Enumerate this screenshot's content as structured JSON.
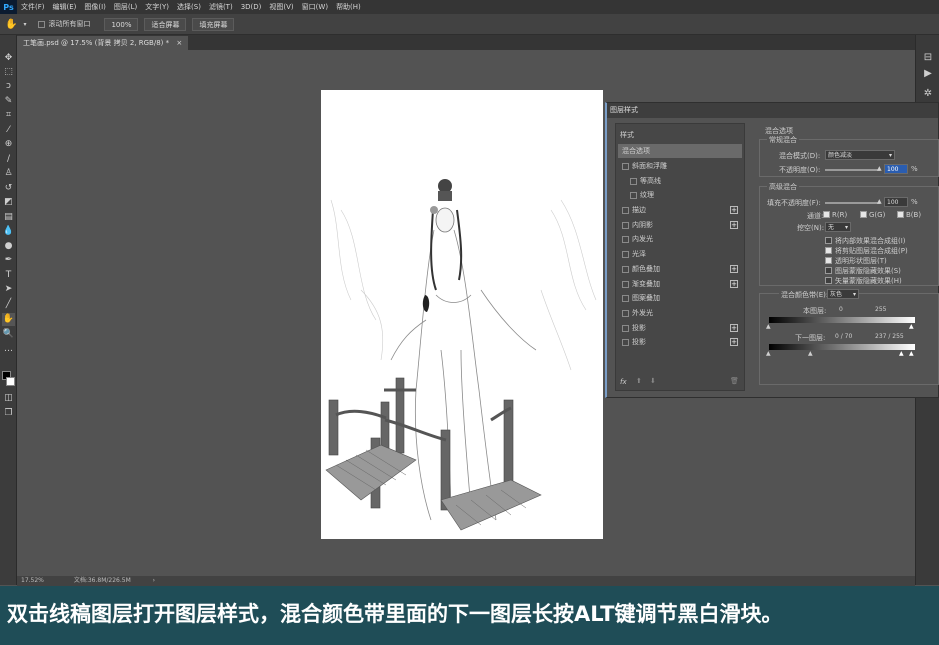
{
  "app": {
    "logo": "Ps"
  },
  "menubar": {
    "items": [
      "文件(F)",
      "编辑(E)",
      "图像(I)",
      "图层(L)",
      "文字(Y)",
      "选择(S)",
      "滤镜(T)",
      "3D(D)",
      "视图(V)",
      "窗口(W)",
      "帮助(H)"
    ]
  },
  "options": {
    "scroll_all": "滚动所有窗口",
    "zoom": "100%",
    "fit_screen": "适合屏幕",
    "fill_screen": "填充屏幕"
  },
  "document": {
    "tab_title": "工笔画.psd @ 17.5% (背景 拷贝 2, RGB/8) *",
    "zoom_status": "17.52%",
    "doc_status": "文档:36.8M/226.5M"
  },
  "dialog": {
    "title": "图层样式",
    "style_list": {
      "header": "样式",
      "items": [
        {
          "label": "混合选项",
          "checkbox": false,
          "plus": false,
          "indent": false,
          "selected": true
        },
        {
          "label": "斜面和浮雕",
          "checkbox": true,
          "plus": false,
          "indent": false
        },
        {
          "label": "等高线",
          "checkbox": true,
          "plus": false,
          "indent": true
        },
        {
          "label": "纹理",
          "checkbox": true,
          "plus": false,
          "indent": true
        },
        {
          "label": "描边",
          "checkbox": true,
          "plus": true,
          "indent": false
        },
        {
          "label": "内阴影",
          "checkbox": true,
          "plus": true,
          "indent": false
        },
        {
          "label": "内发光",
          "checkbox": true,
          "plus": false,
          "indent": false
        },
        {
          "label": "光泽",
          "checkbox": true,
          "plus": false,
          "indent": false
        },
        {
          "label": "颜色叠加",
          "checkbox": true,
          "plus": true,
          "indent": false
        },
        {
          "label": "渐变叠加",
          "checkbox": true,
          "plus": true,
          "indent": false
        },
        {
          "label": "图案叠加",
          "checkbox": true,
          "plus": false,
          "indent": false
        },
        {
          "label": "外发光",
          "checkbox": true,
          "plus": false,
          "indent": false
        },
        {
          "label": "投影",
          "checkbox": true,
          "plus": true,
          "indent": false
        },
        {
          "label": "投影",
          "checkbox": true,
          "plus": true,
          "indent": false
        }
      ],
      "fx": "fx"
    },
    "blending": {
      "section_title": "混合选项",
      "general_title": "常规混合",
      "mode_label": "混合模式(D):",
      "mode_value": "颜色减淡",
      "opacity_label": "不透明度(O):",
      "opacity_value": "100",
      "advanced_title": "高级混合",
      "fill_label": "填充不透明度(F):",
      "fill_value": "100",
      "percent": "%",
      "channels_label": "通道:",
      "channel_r": "R(R)",
      "channel_g": "G(G)",
      "channel_b": "B(B)",
      "knockout_label": "挖空(N):",
      "knockout_value": "无",
      "options": [
        {
          "label": "将内部效果混合成组(I)",
          "checked": false
        },
        {
          "label": "将剪贴图层混合成组(P)",
          "checked": true
        },
        {
          "label": "透明形状图层(T)",
          "checked": true
        },
        {
          "label": "图层蒙版隐藏效果(S)",
          "checked": false
        },
        {
          "label": "矢量蒙版隐藏效果(H)",
          "checked": false
        }
      ],
      "blend_if_label": "混合颜色带(E):",
      "blend_if_value": "灰色",
      "this_layer_label": "本图层:",
      "this_layer_low": "0",
      "this_layer_high": "255",
      "underlying_label": "下一图层:",
      "underlying_values": "0 / 70",
      "underlying_values2": "237 / 255"
    }
  },
  "caption": "双击线稿图层打开图层样式，混合颜色带里面的下一图层长按ALT键调节黑白滑块。",
  "colors": {
    "caption_bg": "#1f4d57",
    "canvas_bg": "#535353",
    "highlight": "#2a5db0"
  }
}
